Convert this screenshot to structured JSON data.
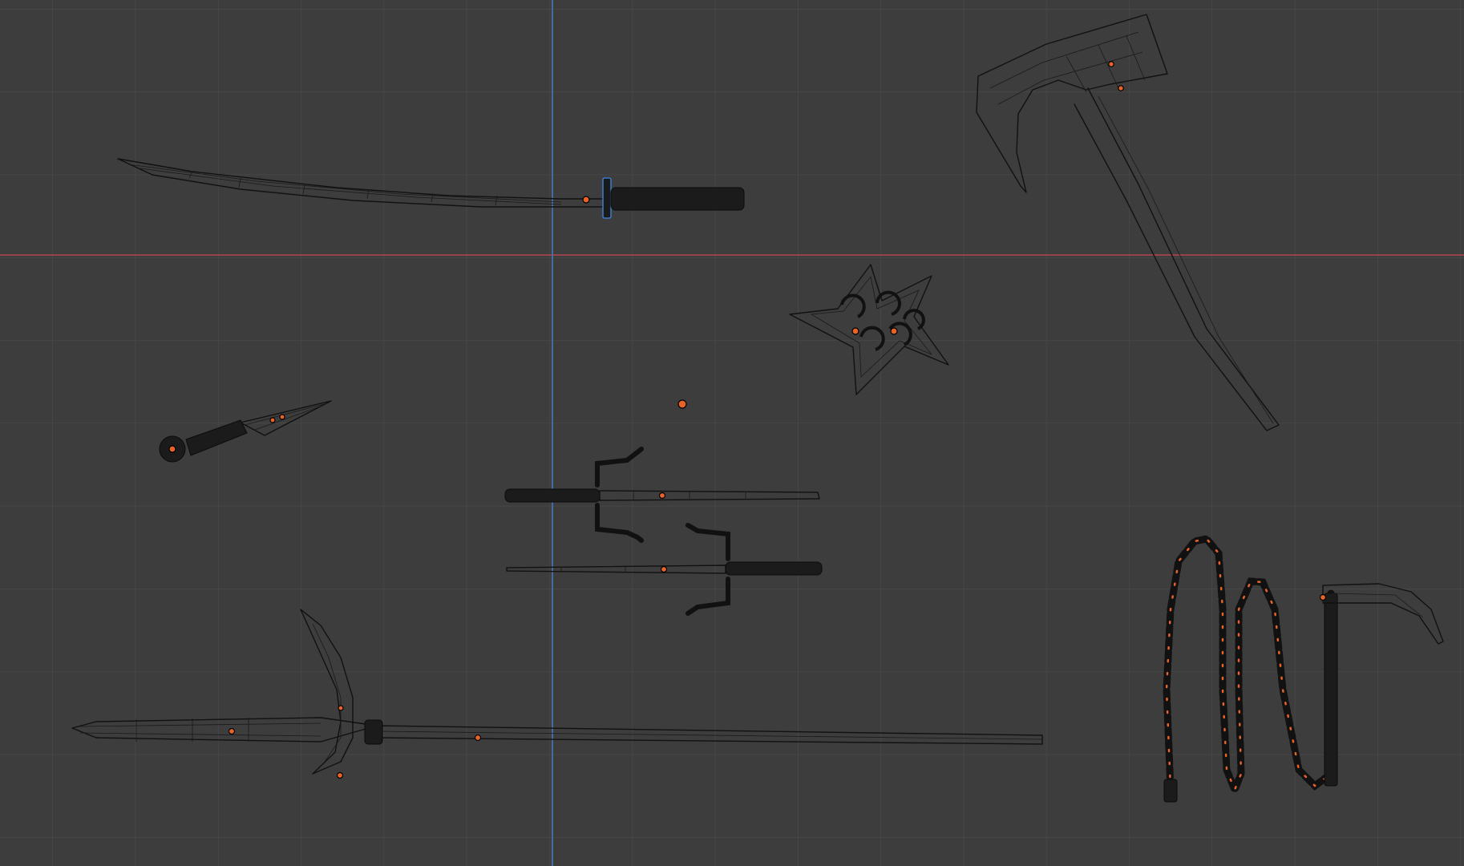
{
  "viewport": {
    "background": "#3d3d3d",
    "grid_color": "#4a4a4a",
    "axis_x_color": "#b54a4a",
    "axis_y_color": "#4a72b8",
    "origin_color": "#e8632a"
  },
  "objects": [
    {
      "name": "katana",
      "icon": "katana-wireframe"
    },
    {
      "name": "axe",
      "icon": "axe-wireframe"
    },
    {
      "name": "shuriken",
      "icon": "shuriken-wireframe"
    },
    {
      "name": "kunai",
      "icon": "kunai-wireframe"
    },
    {
      "name": "sai-upper",
      "icon": "sai-wireframe"
    },
    {
      "name": "sai-lower",
      "icon": "sai-wireframe"
    },
    {
      "name": "naginata",
      "icon": "naginata-wireframe"
    },
    {
      "name": "kusarigama",
      "icon": "kusarigama-wireframe"
    },
    {
      "name": "empty",
      "icon": "empty-origin"
    }
  ]
}
